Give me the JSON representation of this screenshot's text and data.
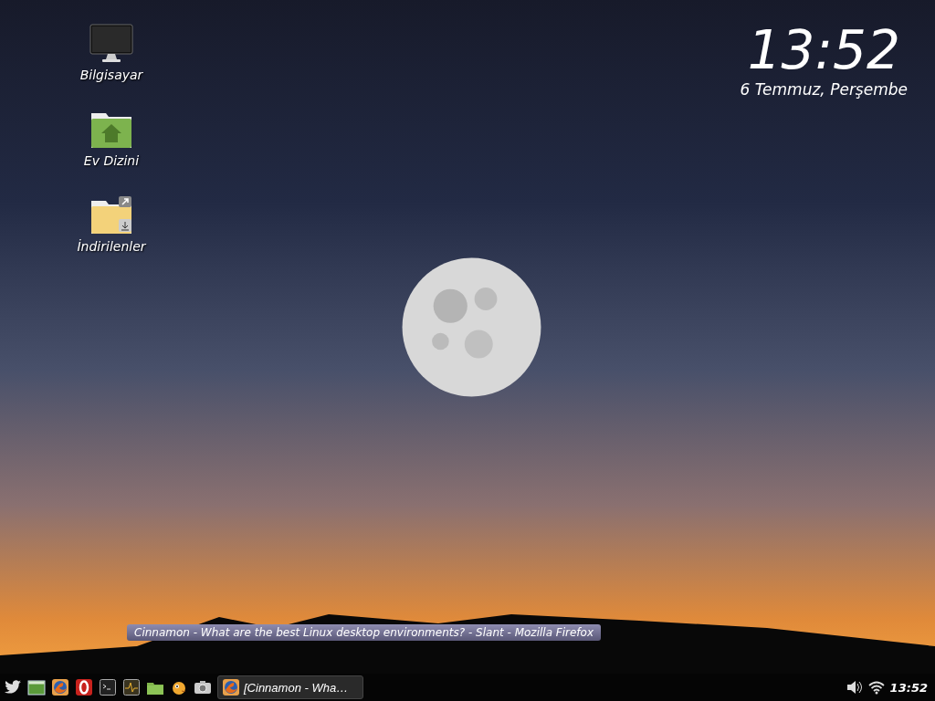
{
  "desktop_icons": [
    {
      "kind": "computer",
      "label": "Bilgisayar"
    },
    {
      "kind": "home",
      "label": "Ev Dizini"
    },
    {
      "kind": "downloads",
      "label": "İndirilenler"
    }
  ],
  "desklet_clock": {
    "time": "13:52",
    "date": "6 Temmuz, Perşembe"
  },
  "taskbar": {
    "launchers": [
      {
        "kind": "bird"
      },
      {
        "kind": "desktop"
      },
      {
        "kind": "browser"
      },
      {
        "kind": "opera"
      },
      {
        "kind": "terminal"
      },
      {
        "kind": "monitor"
      },
      {
        "kind": "folder"
      },
      {
        "kind": "chat"
      },
      {
        "kind": "camera"
      }
    ],
    "windows": [
      {
        "title": "[Cinnamon - Wha…",
        "selected": true
      }
    ],
    "tooltip": "Cinnamon - What are the best Linux desktop environments? - Slant - Mozilla Firefox",
    "clock": "13:52"
  }
}
